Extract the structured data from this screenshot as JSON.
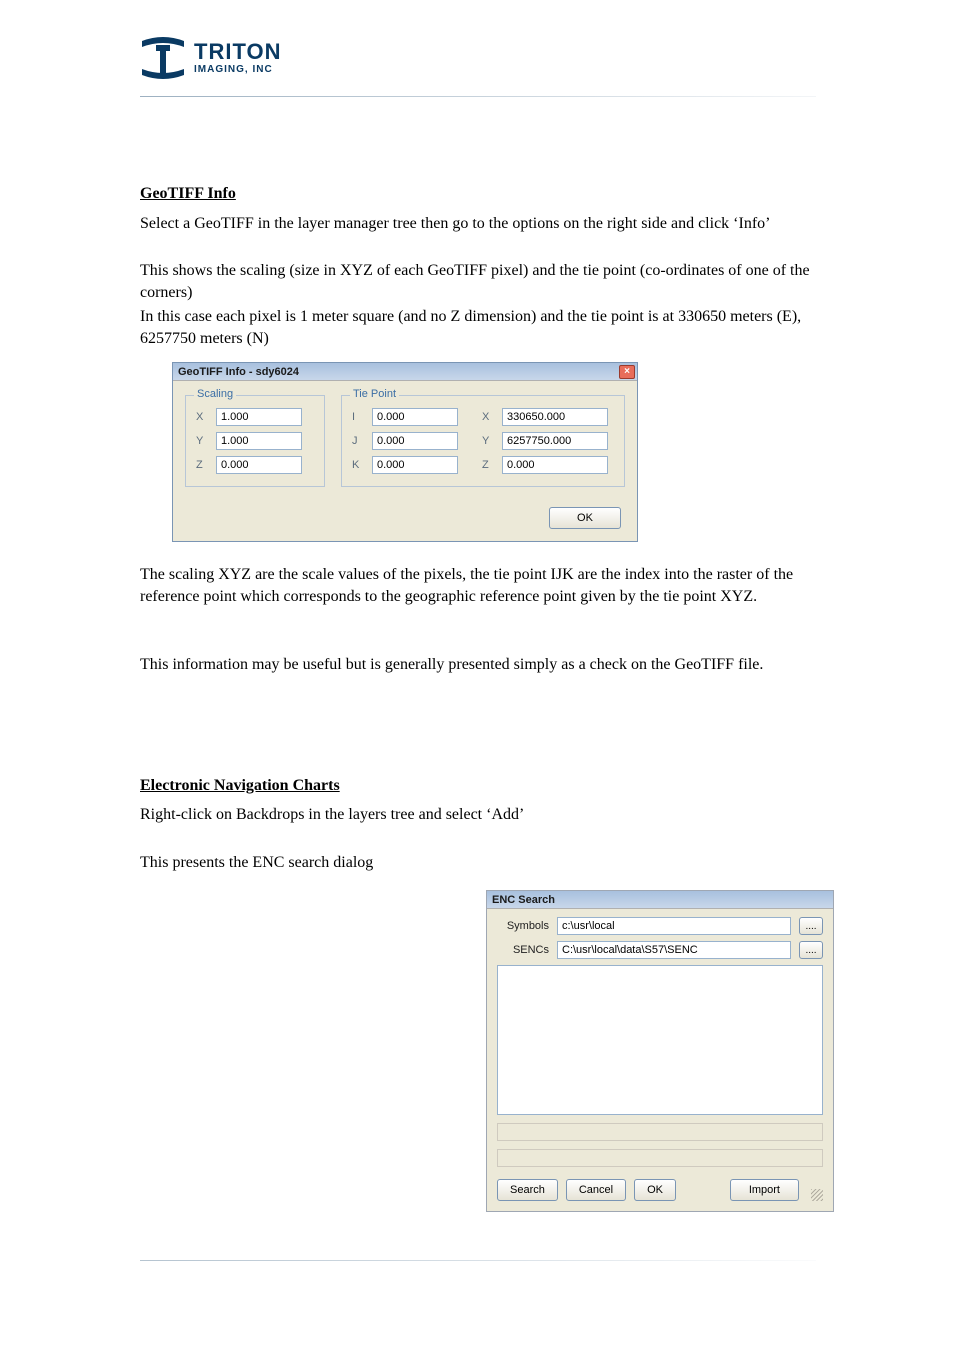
{
  "logo": {
    "line1": "TRITON",
    "line2": "IMAGING, INC"
  },
  "sect1": {
    "heading": "GeoTIFF Info",
    "p1": "Select a GeoTIFF in the layer manager tree then go to the options on the right side and click ‘Info’",
    "p2": "This shows the scaling (size in XYZ of each GeoTIFF pixel) and the tie point (co-ordinates of one of the corners)",
    "p3": "In this case each pixel is 1 meter square (and no Z dimension) and the tie point is at 330650 meters (E), 6257750 meters (N)"
  },
  "geotiff_dialog": {
    "title": "GeoTIFF Info - sdy6024",
    "close_icon": "×",
    "scaling": {
      "legend": "Scaling",
      "rows": {
        "X": "1.000",
        "Y": "1.000",
        "Z": "0.000"
      }
    },
    "tiepoint": {
      "legend": "Tie Point",
      "left": {
        "I": "0.000",
        "J": "0.000",
        "K": "0.000"
      },
      "right": {
        "X": "330650.000",
        "Y": "6257750.000",
        "Z": "0.000"
      }
    },
    "ok_label": "OK"
  },
  "sect1b": {
    "p4": "The scaling XYZ are the scale values of the pixels, the tie point IJK are the index into the raster of the reference point which corresponds to the geographic reference point given by the tie point XYZ.",
    "p5": "This information may be useful but is generally presented simply as a check on the GeoTIFF file."
  },
  "sect2": {
    "heading": "Electronic Navigation Charts",
    "p6": "Right-click on Backdrops in the layers tree  and select ‘Add’",
    "p7": "This presents the ENC search dialog"
  },
  "enc_dialog": {
    "title": "ENC Search",
    "fields": {
      "symbols": {
        "label": "Symbols",
        "value": "c:\\usr\\local"
      },
      "sencs": {
        "label": "SENCs",
        "value": "C:\\usr\\local\\data\\S57\\SENC"
      }
    },
    "browse_label": "....",
    "buttons": {
      "search": "Search",
      "cancel": "Cancel",
      "ok": "OK",
      "import": "Import"
    }
  }
}
